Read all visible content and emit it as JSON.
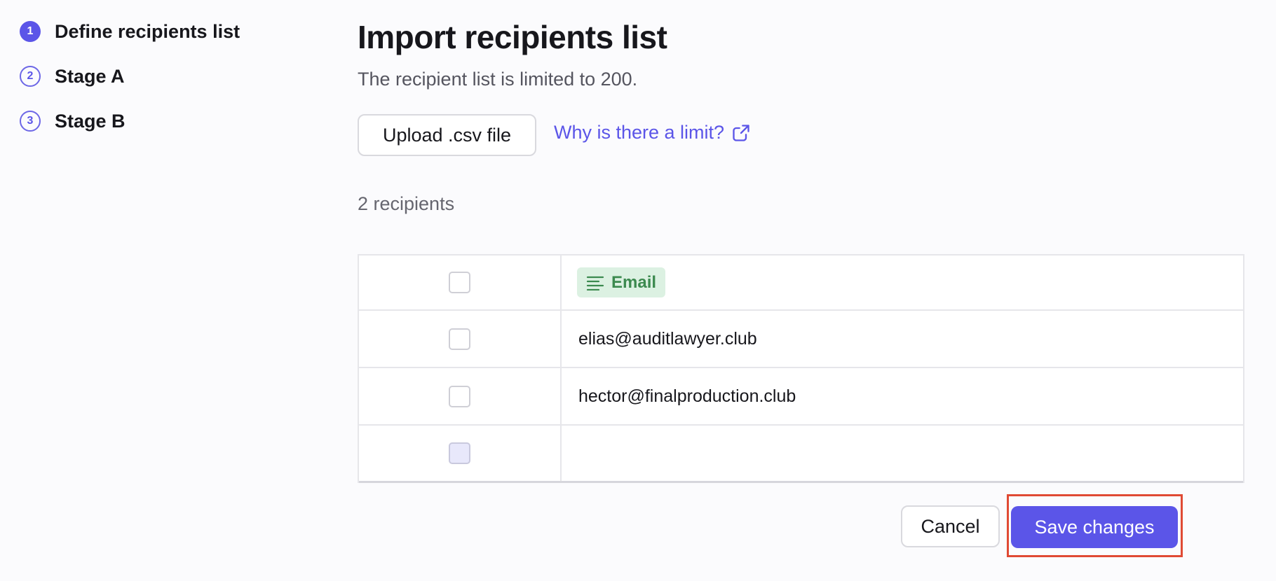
{
  "steps": [
    {
      "number": "1",
      "label": "Define recipients list",
      "state": "active"
    },
    {
      "number": "2",
      "label": "Stage A",
      "state": "pending"
    },
    {
      "number": "3",
      "label": "Stage B",
      "state": "pending"
    }
  ],
  "header": {
    "title": "Import recipients list",
    "subtitle": "The recipient list is limited to 200."
  },
  "actions": {
    "upload_label": "Upload .csv file",
    "limit_link_label": "Why is there a limit?",
    "limit_link_icon": "external-link-icon"
  },
  "recipients": {
    "count_label": "2 recipients"
  },
  "table": {
    "column_header": "Email",
    "column_icon": "text-lines-icon",
    "rows": [
      {
        "email": "elias@auditlawyer.club"
      },
      {
        "email": "hector@finalproduction.club"
      },
      {
        "email": ""
      }
    ]
  },
  "footer": {
    "cancel_label": "Cancel",
    "save_label": "Save changes"
  },
  "colors": {
    "accent": "#5b55e8",
    "tag_bg": "#dcf1e2",
    "tag_text": "#3c8a4f",
    "highlight": "#e04a34"
  }
}
